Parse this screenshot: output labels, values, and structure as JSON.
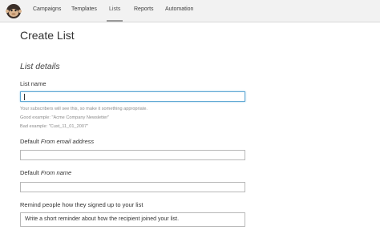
{
  "nav": {
    "items": [
      {
        "label": "Campaigns"
      },
      {
        "label": "Templates"
      },
      {
        "label": "Lists"
      },
      {
        "label": "Reports"
      },
      {
        "label": "Automation"
      }
    ],
    "active": "Lists"
  },
  "page": {
    "title": "Create List",
    "section_title": "List details"
  },
  "form": {
    "list_name": {
      "label": "List name",
      "value": "",
      "help": [
        "Your subscribers will see this, so make it something appropriate.",
        "Good example: \"Acme Company Newsletter\"",
        "Bad example: \"Cust_11_01_2007\""
      ]
    },
    "from_email": {
      "label_prefix": "Default ",
      "label_em": "From email address",
      "value": ""
    },
    "from_name": {
      "label_prefix": "Default ",
      "label_em": "From name",
      "value": ""
    },
    "reminder": {
      "label": "Remind people how they signed up to your list",
      "value": "Write a short reminder about how the recipient joined your list."
    }
  },
  "icons": {
    "logo": "chimp-logo-icon"
  }
}
